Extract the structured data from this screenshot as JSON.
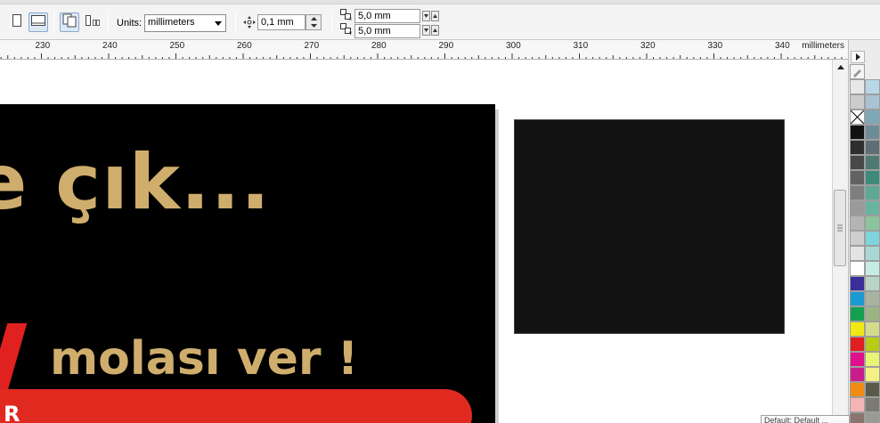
{
  "toolbar": {
    "units_label": "Units:",
    "units_value": "millimeters",
    "nudge_value": "0,1 mm",
    "dup_x_value": "5,0 mm",
    "dup_y_value": "5,0 mm",
    "icons": [
      "portrait-page-icon",
      "landscape-page-icon",
      "all-pages-icon",
      "current-page-icon",
      "nudge-icon",
      "duplicate-distance-icon"
    ]
  },
  "ruler": {
    "labels": [
      "230",
      "240",
      "250",
      "260",
      "270",
      "280",
      "290",
      "300",
      "310",
      "320",
      "330",
      "340"
    ],
    "unit": "millimeters"
  },
  "canvas": {
    "headline": "e çık...",
    "subline": "molası ver !",
    "redbar_text": "R"
  },
  "palette": {
    "swatches": [
      [
        "#e8e8e8",
        "#b8d8e8"
      ],
      [
        "#cccccc",
        "#a8c4d4"
      ],
      [
        "none",
        "#7ea8b8"
      ],
      [
        "#111111",
        "#6e8c98"
      ],
      [
        "#2e2e2e",
        "#5e6e74"
      ],
      [
        "#484848",
        "#4e7a72"
      ],
      [
        "#626262",
        "#3e8a7a"
      ],
      [
        "#7e7e7e",
        "#5ea894"
      ],
      [
        "#9a9a9a",
        "#68b4a0"
      ],
      [
        "#b4b4b4",
        "#8cc49c"
      ],
      [
        "#cecece",
        "#7ed4dc"
      ],
      [
        "#e4e4e4",
        "#a8d8d4"
      ],
      [
        "#ffffff",
        "#c4ece4"
      ],
      [
        "#3a2e9a",
        "#b8d4c4"
      ],
      [
        "#1a9ad4",
        "#a8b4a0"
      ],
      [
        "#14a050",
        "#9cb484"
      ],
      [
        "#f0e814",
        "#d4dc8c"
      ],
      [
        "#e02020",
        "#b8cc14"
      ],
      [
        "#e0108c",
        "#e8f474"
      ],
      [
        "#c81e8c",
        "#f4f084"
      ],
      [
        "#f08c14",
        "#5a5a4a"
      ],
      [
        "#f4b4b4",
        "#7a7a70"
      ],
      [
        "#8a7470",
        "#9a9a94"
      ],
      [
        "#a89490",
        "#b8b4a8"
      ]
    ]
  },
  "status_tip": "Default: Default ..."
}
